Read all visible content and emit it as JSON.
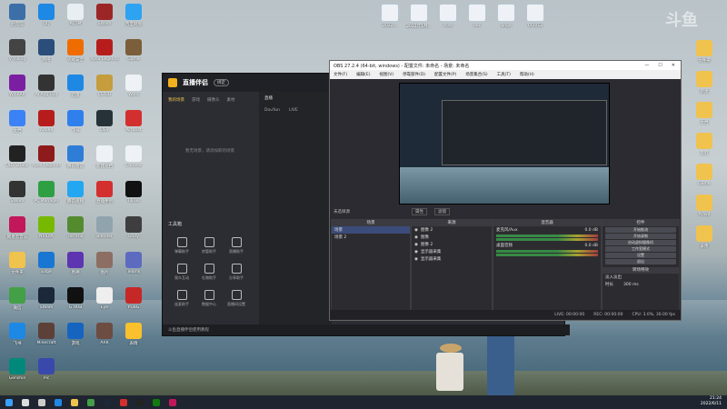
{
  "desktop": {
    "icons_left": [
      {
        "label": "此电脑",
        "color": "#3c6ea8"
      },
      {
        "label": "QQ",
        "color": "#1e88e5"
      },
      {
        "label": "ACTM",
        "color": "#e9eef3"
      },
      {
        "label": "Steam",
        "color": "#9c2626"
      },
      {
        "label": "百度网盘",
        "color": "#2ea3f2"
      },
      {
        "label": "V Rising",
        "color": "#444"
      },
      {
        "label": "网络",
        "color": "#2a4d7a"
      },
      {
        "label": "火绒安全",
        "color": "#ef6c00"
      },
      {
        "label": "Apex Legends",
        "color": "#b71c1c"
      },
      {
        "label": "Game",
        "color": "#7b5e3a"
      },
      {
        "label": "WinRAR",
        "color": "#7b1fa2"
      },
      {
        "label": "AI Avg Tool",
        "color": "#333"
      },
      {
        "label": "迅雷",
        "color": "#1e88e5"
      },
      {
        "label": "CS:GO",
        "color": "#c59d3c"
      },
      {
        "label": "Word",
        "color": "#eef2f6"
      },
      {
        "label": "文档",
        "color": "#3b82f6"
      },
      {
        "label": "Adobe",
        "color": "#b71c1c"
      },
      {
        "label": "飞书",
        "color": "#2f80ed"
      },
      {
        "label": "DEV",
        "color": "#263238"
      },
      {
        "label": "Acrobat",
        "color": "#d32f2f"
      },
      {
        "label": "OBS Studio",
        "color": "#222"
      },
      {
        "label": "Apex Legends",
        "color": "#8e1b1b"
      },
      {
        "label": "腾讯会议",
        "color": "#2e7dd7"
      },
      {
        "label": "新建文档",
        "color": "#eef2f6"
      },
      {
        "label": "Chrome",
        "color": "#eef2f6"
      },
      {
        "label": "Steam",
        "color": "#333"
      },
      {
        "label": "PC Manager",
        "color": "#2ea043"
      },
      {
        "label": "腾讯视频",
        "color": "#23a7f2"
      },
      {
        "label": "直播伴侣",
        "color": "#d32f2f"
      },
      {
        "label": "TikTok",
        "color": "#111"
      },
      {
        "label": "网易云音乐",
        "color": "#c2185b"
      },
      {
        "label": "NVIDIA",
        "color": "#76b900"
      },
      {
        "label": "Terraria",
        "color": "#558b2f"
      },
      {
        "label": "Blender",
        "color": "#90a4ae"
      },
      {
        "label": "Unity",
        "color": "#3e3e3e"
      },
      {
        "label": "文件夹",
        "color": "#f0c24e"
      },
      {
        "label": "Edge",
        "color": "#1976d2"
      },
      {
        "label": "原神",
        "color": "#5e35b1"
      },
      {
        "label": "图片",
        "color": "#8d6e63"
      },
      {
        "label": "Teams",
        "color": "#5c6bc0"
      },
      {
        "label": "微信",
        "color": "#43a047"
      },
      {
        "label": "Steam",
        "color": "#1b2838"
      },
      {
        "label": "G HUB",
        "color": "#111"
      },
      {
        "label": "Eye",
        "color": "#eee"
      },
      {
        "label": "PUBG",
        "color": "#c62828"
      },
      {
        "label": "飞书",
        "color": "#1e88e5"
      },
      {
        "label": "Minecraft",
        "color": "#5d4037"
      },
      {
        "label": "游戏",
        "color": "#1565c0"
      },
      {
        "label": "ARK",
        "color": "#6d4c41"
      },
      {
        "label": "表情",
        "color": "#fbc02d"
      },
      {
        "label": "Genshin",
        "color": "#00897b"
      },
      {
        "label": "Pic",
        "color": "#3949ab"
      }
    ],
    "icons_top": [
      {
        "label": "2022..."
      },
      {
        "label": "2022年1月..."
      },
      {
        "label": "mse"
      },
      {
        "label": "doc"
      },
      {
        "label": "gogo"
      },
      {
        "label": "LY2012"
      }
    ],
    "icons_right": [
      {
        "label": "文件夹"
      },
      {
        "label": "新建"
      },
      {
        "label": "文档"
      },
      {
        "label": "资料"
      },
      {
        "label": "Game"
      },
      {
        "label": "Arlive"
      },
      {
        "label": "录像"
      }
    ],
    "watermark": "斗鱼"
  },
  "companion": {
    "title": "直播伴侣",
    "badge": "绑定",
    "tabs": [
      "我的场景",
      "游戏",
      "摄像头",
      "素材"
    ],
    "empty_text": "暂无场景，请添加新的场景",
    "tools_title": "工具箱",
    "tools": [
      "弹幕助手",
      "房管助手",
      "直播助手",
      "观众互动",
      "礼物助手",
      "分享助手",
      "连麦助手",
      "数据中心",
      "直播间设置"
    ],
    "mid_tabs": [
      "DouYun",
      "LIVE"
    ],
    "mid_header": "直播",
    "preview_hint": "我的 Live 指定场景素材",
    "status": "斗鱼直播伴侣使用教程"
  },
  "obs": {
    "title": "OBS 27.2.4 (64-bit, windows) - 配置文件: 未命名 - 场景: 未命名",
    "window_controls": [
      "—",
      "☐",
      "✕"
    ],
    "menu": [
      "文件(F)",
      "编辑(E)",
      "视图(V)",
      "停靠部件(D)",
      "配置文件(P)",
      "场景集合(S)",
      "工具(T)",
      "帮助(H)"
    ],
    "mode_label": "未选择源",
    "props_btn": "属性",
    "filters_btn": "滤镜",
    "docks": {
      "scenes": {
        "title": "场景",
        "items": [
          "场景",
          "场景 2"
        ]
      },
      "sources": {
        "title": "来源",
        "items": [
          "图像 2",
          "图像",
          "图像 2",
          "显示器采集",
          "显示器采集"
        ]
      },
      "mixer": {
        "title": "混音器",
        "items": [
          "麦克风/Aux",
          "桌面音频"
        ],
        "db": "0.0 dB"
      },
      "transitions": {
        "title": "转场特效",
        "mode": "淡入淡出",
        "duration_label": "时长",
        "duration": "300 ms"
      },
      "controls": {
        "title": "控件",
        "buttons": [
          "开始推流",
          "开始录制",
          "启动虚拟摄像机",
          "工作室模式",
          "设置",
          "退出"
        ]
      }
    },
    "status": {
      "live": "LIVE: 00:00:00",
      "rec": "REC: 00:00:00",
      "cpu": "CPU: 3.0%, 30.00 fps"
    }
  },
  "taskbar": {
    "time": "21:24",
    "date": "2022/6/11"
  }
}
